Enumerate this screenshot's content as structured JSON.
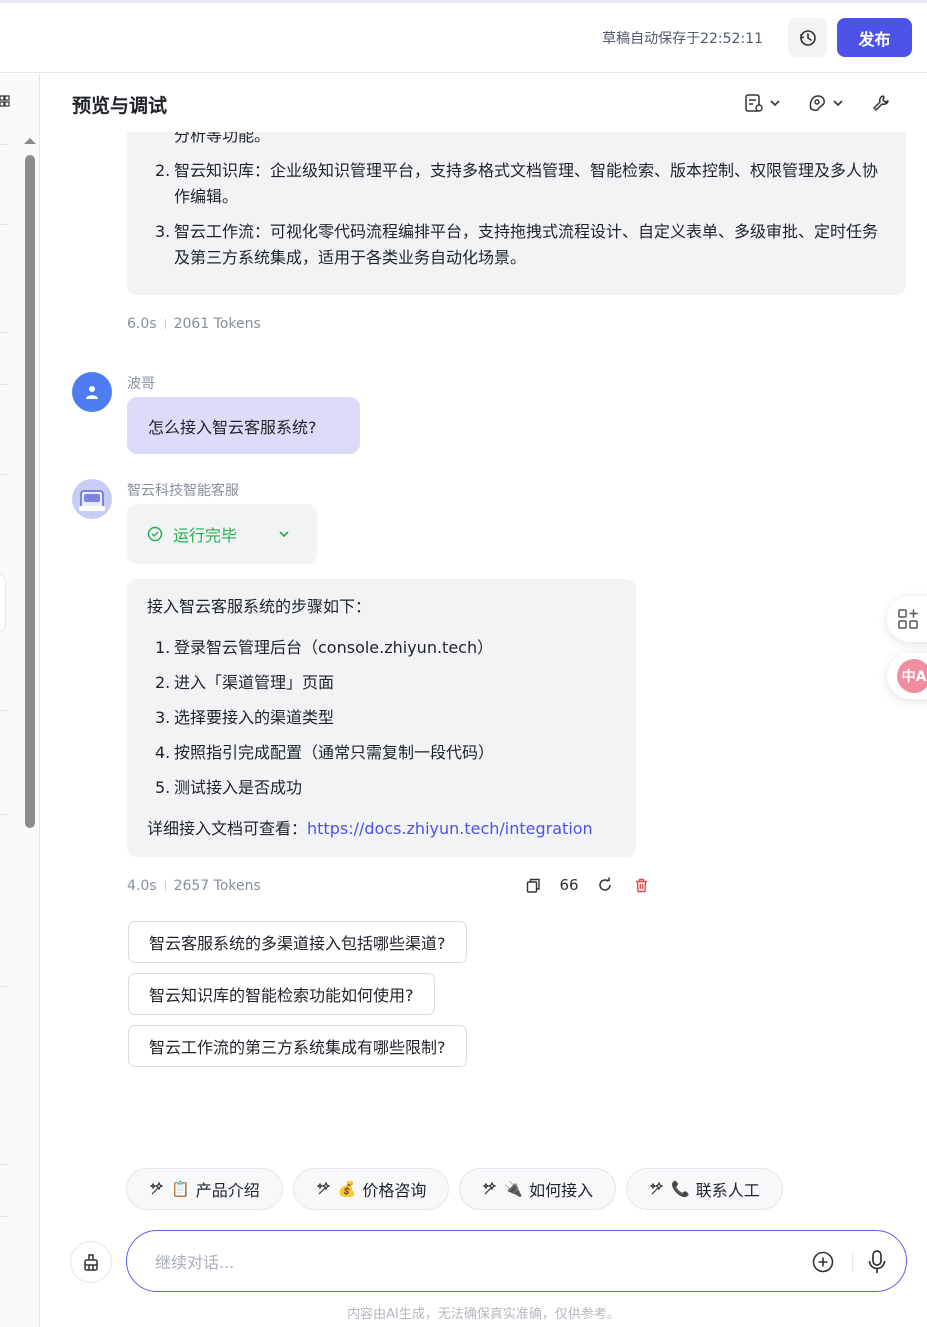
{
  "topbar": {
    "save_status": "草稿自动保存于22:52:11",
    "history_icon": "history-icon",
    "publish_label": "发布"
  },
  "panel": {
    "title": "预览与调试",
    "tools": [
      "chat-settings-icon",
      "debug-icon",
      "tool-icon"
    ]
  },
  "messages": {
    "prev_answer": {
      "cut_line": "分析等功能。",
      "items": [
        {
          "num": "2.",
          "text": "智云知识库：企业级知识管理平台，支持多格式文档管理、智能检索、版本控制、权限管理及多人协作编辑。"
        },
        {
          "num": "3.",
          "text": "智云工作流：可视化零代码流程编排平台，支持拖拽式流程设计、自定义表单、多级审批、定时任务及第三方系统集成，适用于各类业务自动化场景。"
        }
      ],
      "time": "6.0s",
      "tokens": "2061 Tokens"
    },
    "user": {
      "name": "波哥",
      "text": "怎么接入智云客服系统?"
    },
    "bot": {
      "name": "智云科技智能客服",
      "run_status": "运行完毕",
      "intro": "接入智云客服系统的步骤如下：",
      "steps": [
        {
          "num": "1.",
          "text": "登录智云管理后台（console.zhiyun.tech）"
        },
        {
          "num": "2.",
          "text": "进入「渠道管理」页面"
        },
        {
          "num": "3.",
          "text": "选择要接入的渠道类型"
        },
        {
          "num": "4.",
          "text": "按照指引完成配置（通常只需复制一段代码）"
        },
        {
          "num": "5.",
          "text": "测试接入是否成功"
        }
      ],
      "doc_prefix": "详细接入文档可查看：",
      "doc_link": "https://docs.zhiyun.tech/integration",
      "time": "4.0s",
      "tokens": "2657 Tokens",
      "quote_label": "66"
    }
  },
  "suggestions": [
    "智云客服系统的多渠道接入包括哪些渠道?",
    "智云知识库的智能检索功能如何使用?",
    "智云工作流的第三方系统集成有哪些限制?"
  ],
  "shortcuts": [
    {
      "emoji": "📋",
      "label": "产品介绍"
    },
    {
      "emoji": "💰",
      "label": "价格咨询"
    },
    {
      "emoji": "🔌",
      "label": "如何接入"
    },
    {
      "emoji": "📞",
      "label": "联系人工"
    }
  ],
  "input": {
    "placeholder": "继续对话...",
    "value": ""
  },
  "disclaimer": "内容由AI生成，无法确保真实准确，仅供参考。",
  "float": {
    "translate_label": "中A"
  },
  "colors": {
    "primary": "#4d53e8",
    "user_bubble": "#dcdcfa",
    "success": "#23b04d",
    "delete": "#e5484d"
  }
}
